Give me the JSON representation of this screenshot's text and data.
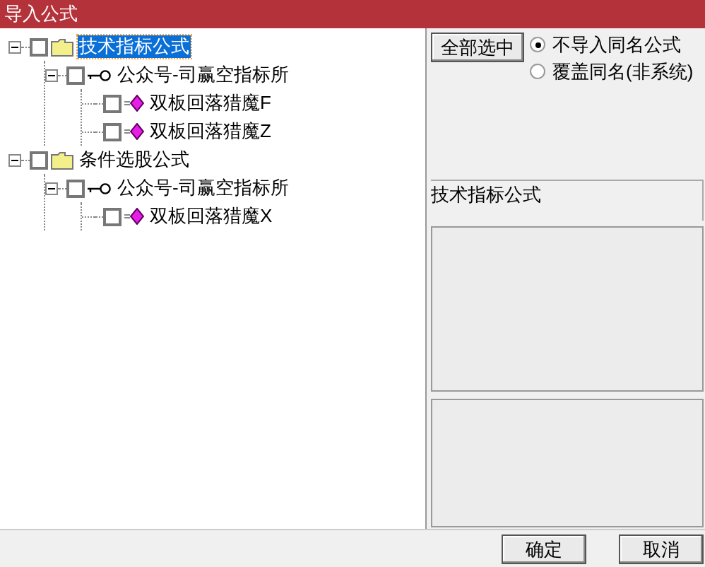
{
  "window": {
    "title": "导入公式"
  },
  "tree": [
    {
      "kind": "folder",
      "label": "技术指标公式",
      "checked": false,
      "expanded": true,
      "selected": true,
      "children": [
        {
          "kind": "group",
          "label": "公众号-司赢空指标所",
          "checked": false,
          "expanded": true,
          "selected": false,
          "children": [
            {
              "kind": "formula",
              "label": "双板回落猎魔F",
              "checked": false,
              "selected": false
            },
            {
              "kind": "formula",
              "label": "双板回落猎魔Z",
              "checked": false,
              "selected": false
            }
          ]
        }
      ]
    },
    {
      "kind": "folder",
      "label": "条件选股公式",
      "checked": false,
      "expanded": true,
      "selected": false,
      "children": [
        {
          "kind": "group",
          "label": "公众号-司赢空指标所",
          "checked": false,
          "expanded": true,
          "selected": false,
          "children": [
            {
              "kind": "formula",
              "label": "双板回落猎魔X",
              "checked": false,
              "selected": false
            }
          ]
        }
      ]
    }
  ],
  "select_all_button": "全部选中",
  "options": [
    {
      "label": "不导入同名公式",
      "selected": true
    },
    {
      "label": "覆盖同名(非系统)",
      "selected": false
    }
  ],
  "info_label": "技术指标公式",
  "buttons": [
    "确定",
    "取消"
  ]
}
